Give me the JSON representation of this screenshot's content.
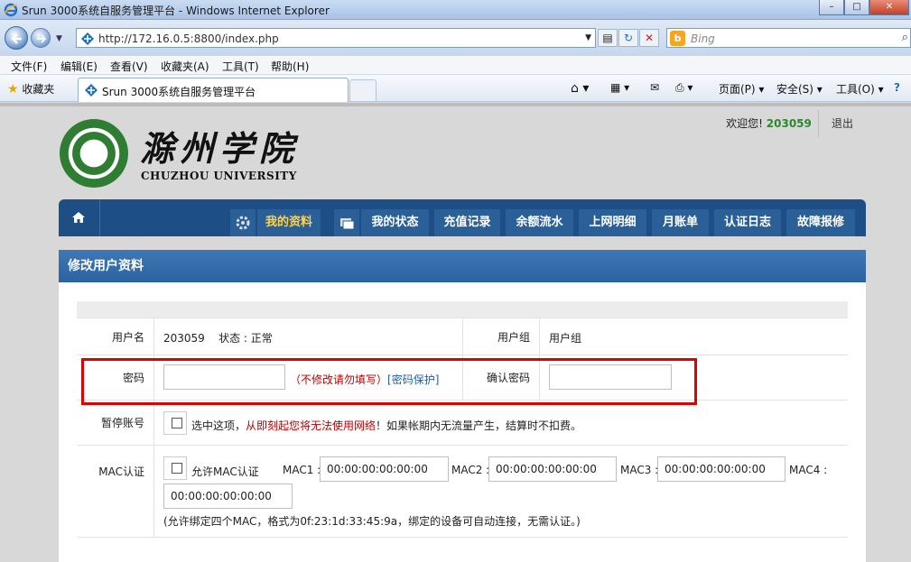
{
  "window": {
    "title": "Srun 3000系统自服务管理平台 - Windows Internet Explorer",
    "min_icon": "minimize-icon",
    "max_icon": "maximize-icon",
    "close_icon": "close-icon"
  },
  "browser": {
    "url": "http://172.16.0.5:8800/index.php",
    "search_placeholder": "Bing",
    "menu": [
      "文件(F)",
      "编辑(E)",
      "查看(V)",
      "收藏夹(A)",
      "工具(T)",
      "帮助(H)"
    ],
    "favorites_label": "收藏夹",
    "tab_title": "Srun 3000系统自服务管理平台",
    "commands": [
      "页面(P) ▾",
      "安全(S) ▾",
      "工具(O) ▾"
    ]
  },
  "site": {
    "logo_cn": "滁州学院",
    "logo_en": "CHUZHOU UNIVERSITY",
    "welcome_prefix": "欢迎您!",
    "user_id": "203059",
    "logout": "退出",
    "nav": [
      {
        "label": "我的资料",
        "active": true
      },
      {
        "label": "我的状态"
      },
      {
        "label": "充值记录"
      },
      {
        "label": "余额流水"
      },
      {
        "label": "上网明细"
      },
      {
        "label": "月账单"
      },
      {
        "label": "认证日志"
      },
      {
        "label": "故障报修"
      }
    ]
  },
  "panel": {
    "title": "修改用户资料",
    "form": {
      "username_label": "用户名",
      "username_value": "203059",
      "status_label": "状态 :",
      "status_value": "正常",
      "group_label": "用户组",
      "group_value": "用户组",
      "password_label": "密码",
      "password_note": "（不修改请勿填写）",
      "password_protect": "[密码保护]",
      "confirm_label": "确认密码",
      "suspend_label": "暂停账号",
      "suspend_text_prefix": "选中这项，",
      "suspend_text_warning": "从即刻起您将无法使用网络",
      "suspend_text_suffix": "！如果帐期内无流量产生，结算时不扣费。",
      "mac_label": "MAC认证",
      "mac_allow": "允许MAC认证",
      "mac1_label": "MAC1 :",
      "mac1_value": "00:00:00:00:00:00",
      "mac2_label": "MAC2 :",
      "mac2_value": "00:00:00:00:00:00",
      "mac3_label": "MAC3 :",
      "mac3_value": "00:00:00:00:00:00",
      "mac4_label": "MAC4 :",
      "mac4_value": "00:00:00:00:00:00",
      "mac_note": "(允许绑定四个MAC，格式为0f:23:1d:33:45:9a，绑定的设备可自动连接，无需认证。)"
    }
  },
  "colors": {
    "nav_bg": "#1d4f86",
    "nav_active": "#ffd24a",
    "header_bg": "#2c62a0",
    "highlight": "#e00000",
    "warning": "#c00000",
    "link": "#1f5fa8",
    "user_id": "#2a8a2a"
  }
}
